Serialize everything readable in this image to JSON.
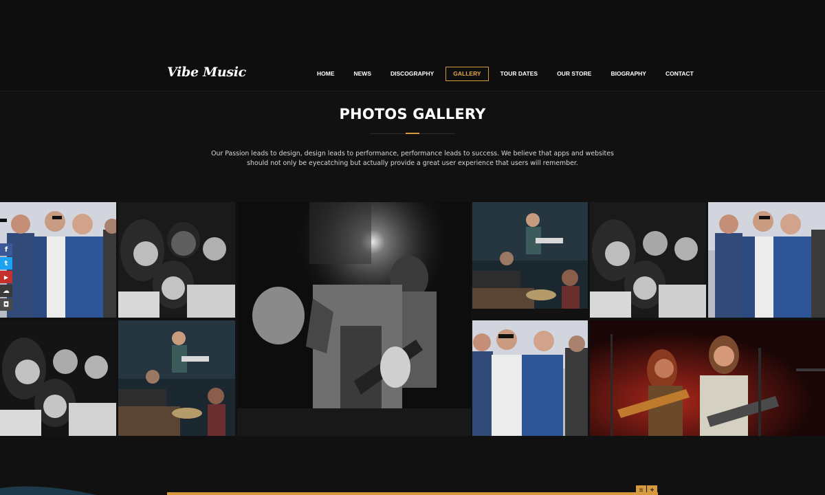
{
  "brand": {
    "logo_text": "Vibe Music"
  },
  "nav": {
    "items": [
      {
        "label": "HOME",
        "active": false
      },
      {
        "label": "NEWS",
        "active": false
      },
      {
        "label": "DISCOGRAPHY",
        "active": false
      },
      {
        "label": "GALLERY",
        "active": true
      },
      {
        "label": "TOUR DATES",
        "active": false
      },
      {
        "label": "OUR STORE",
        "active": false
      },
      {
        "label": "BIOGRAPHY",
        "active": false
      },
      {
        "label": "CONTACT",
        "active": false
      }
    ]
  },
  "section": {
    "title": "PHOTOS GALLERY",
    "description": "Our Passion leads to design, design leads to performance, performance leads to success. We believe that apps and websites should not only be eyecatching but actually provide a great user experience that users will remember."
  },
  "social": {
    "items": [
      {
        "icon": "facebook-icon",
        "glyph": "f",
        "color": "#3b5998"
      },
      {
        "icon": "twitter-icon",
        "glyph": "t",
        "color": "#1da1f2"
      },
      {
        "icon": "youtube-icon",
        "glyph": "▶",
        "color": "#c4302b"
      },
      {
        "icon": "soundcloud-icon",
        "glyph": "☁",
        "color": "#3a3a3a"
      },
      {
        "icon": "instagram-icon",
        "glyph": "◘",
        "color": "#4a4a4a"
      }
    ]
  },
  "gallery": {
    "photos": [
      {
        "name": "photo-band-four-men-denim"
      },
      {
        "name": "photo-bw-four-musicians"
      },
      {
        "name": "photo-bw-guitarist-live"
      },
      {
        "name": "photo-studio-band-keyboards"
      },
      {
        "name": "photo-bw-four-musicians-2"
      },
      {
        "name": "photo-band-four-men-denim-2"
      },
      {
        "name": "photo-bw-four-musicians-3"
      },
      {
        "name": "photo-studio-band-keyboards-2"
      },
      {
        "name": "photo-band-four-men-denim-3"
      },
      {
        "name": "photo-concert-red-light"
      }
    ]
  },
  "bottom_controls": {
    "menu_glyph": "≡",
    "plus_glyph": "+"
  },
  "colors": {
    "accent": "#d69a3d",
    "background": "#111111"
  }
}
